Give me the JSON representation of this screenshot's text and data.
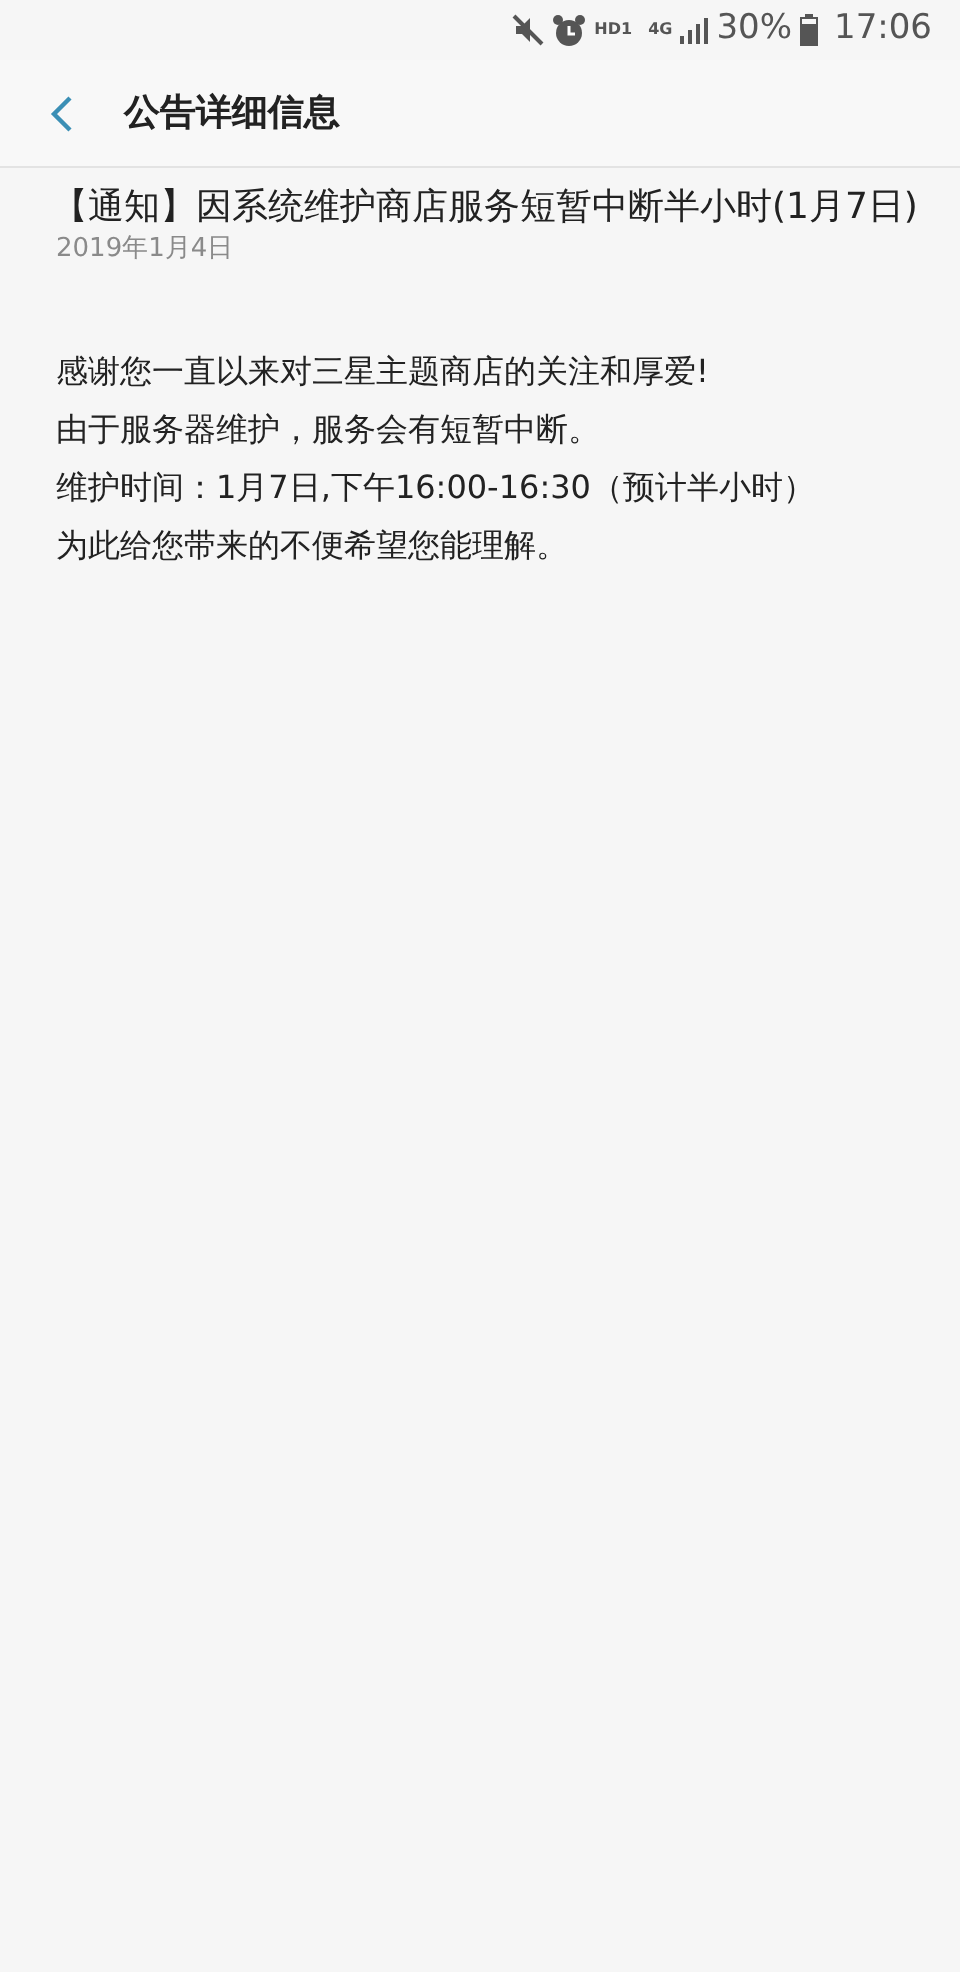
{
  "status_bar": {
    "hd_label": "HD1",
    "network": "4G",
    "battery": "30%",
    "time": "17:06"
  },
  "header": {
    "title": "公告详细信息"
  },
  "notice": {
    "title": "【通知】因系统维护商店服务短暂中断半小时(1月7日)",
    "date": "2019年1月4日",
    "body": [
      "感谢您一直以来对三星主题商店的关注和厚爱!",
      "由于服务器维护，服务会有短暂中断。",
      "维护时间：1月7日,下午16:00-16:30（预计半小时）",
      "为此给您带来的不便希望您能理解。"
    ]
  }
}
